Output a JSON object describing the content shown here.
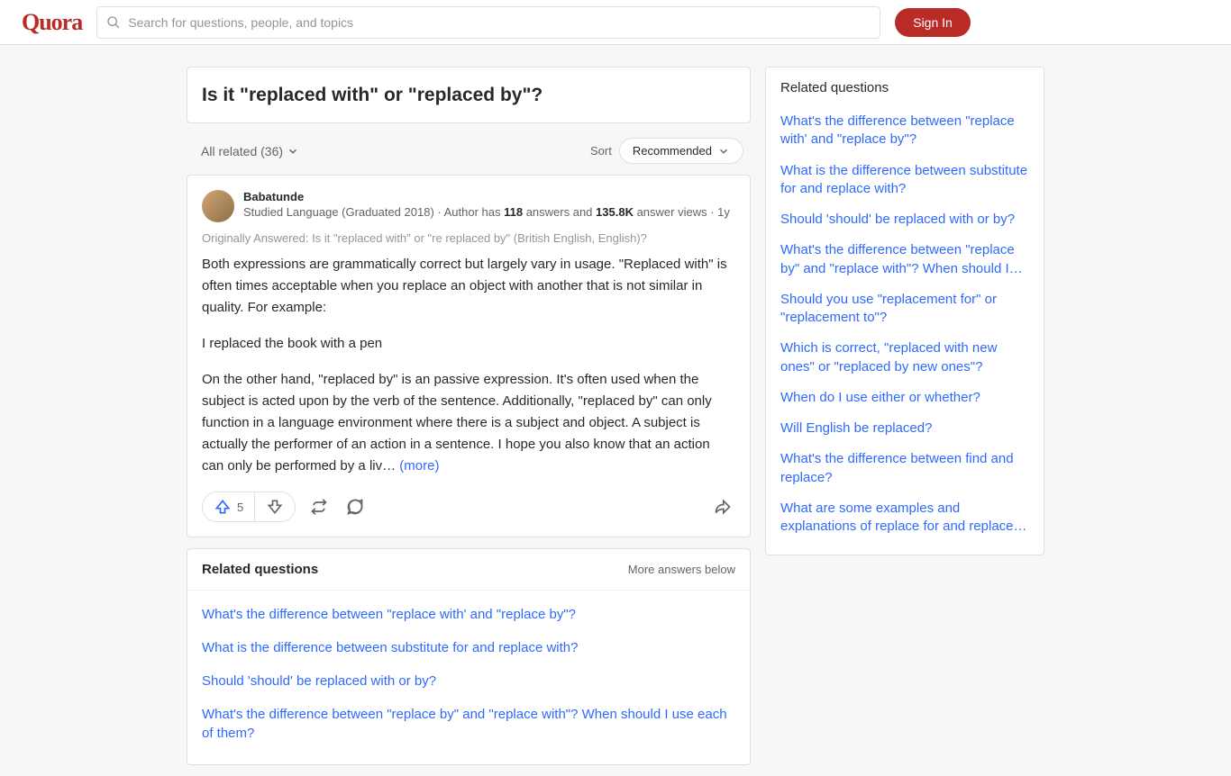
{
  "header": {
    "logo": "Quora",
    "search_placeholder": "Search for questions, people, and topics",
    "signin": "Sign In"
  },
  "question": {
    "title": "Is it \"replaced with\" or \"replaced by\"?"
  },
  "filter": {
    "all_related": "All related (36)",
    "sort_label": "Sort",
    "sort_value": "Recommended"
  },
  "answer": {
    "author": "Babatunde",
    "cred_prefix": "Studied Language (Graduated 2018) · Author has ",
    "answers_count": "118",
    "answers_suffix": " answers and ",
    "views_count": "135.8K",
    "views_suffix": " answer views · ",
    "age": "1y",
    "originally": "Originally Answered: Is it \"replaced with\" or \"re replaced by\" (British English, English)?",
    "p1": "Both expressions are grammatically correct but largely vary in usage. \"Replaced with\" is often times acceptable when you replace an object with another that is not similar in quality. For example:",
    "p2": "I replaced the book with a pen",
    "p3": "On the other hand, \"replaced by\" is an passive expression. It's often used when the subject is acted upon by the verb of the sentence. Additionally, \"replaced by\" can only function in a language environment where there is a subject and object. A subject is actually the performer of an action in a sentence. I hope you also know that an action can only be performed by a liv… ",
    "more": "(more)",
    "upvotes": "5"
  },
  "related_inline": {
    "title": "Related questions",
    "more_below": "More answers below",
    "links": [
      "What's the difference between \"replace with' and \"replace by\"?",
      "What is the difference between substitute for and replace with?",
      "Should 'should' be replaced with or by?",
      "What's the difference between \"replace by\" and \"replace with\"? When should I use each of them?"
    ]
  },
  "sidebar": {
    "title": "Related questions",
    "links": [
      "What's the difference between \"replace with' and \"replace by\"?",
      "What is the difference between substitute for and replace with?",
      "Should 'should' be replaced with or by?",
      "What's the difference between \"replace by\" and \"replace with\"? When should I…",
      "Should you use \"replacement for\" or \"replacement to\"?",
      "Which is correct, \"replaced with new ones\" or \"replaced by new ones\"?",
      "When do I use either or whether?",
      "Will English be replaced?",
      "What's the difference between find and replace?",
      "What are some examples and explanations of replace for and replace…"
    ]
  }
}
